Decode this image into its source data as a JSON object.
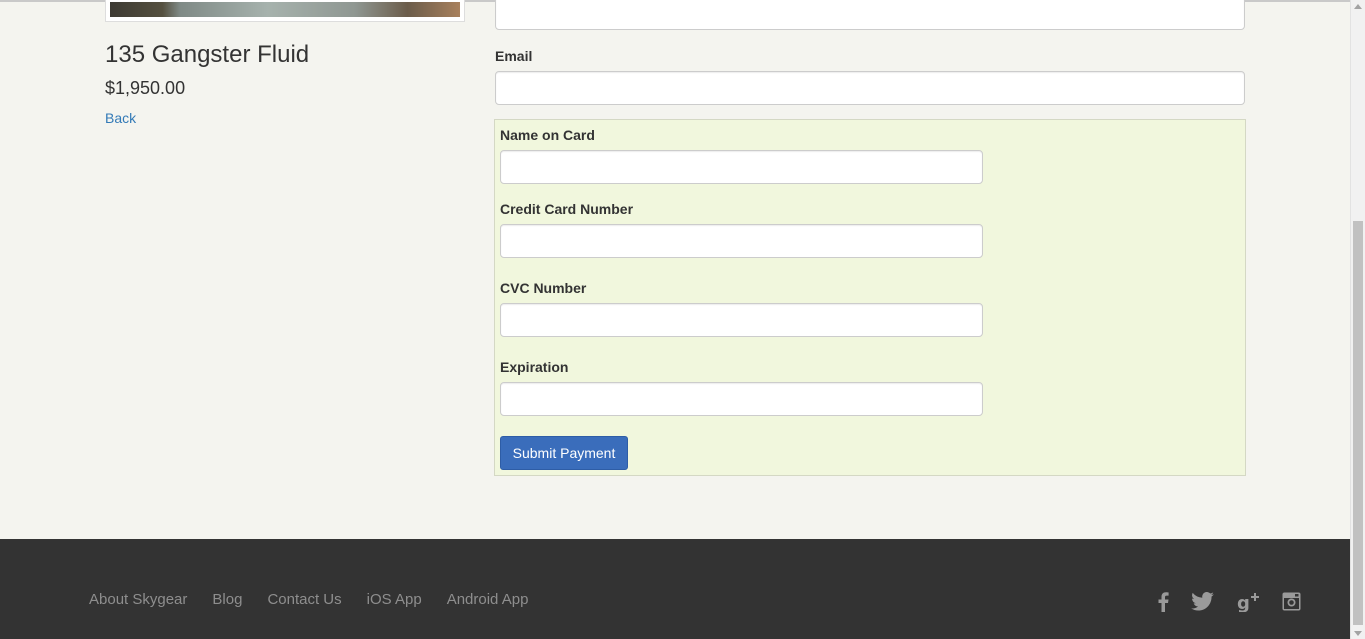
{
  "product": {
    "title": "135 Gangster Fluid",
    "price": "$1,950.00",
    "back_label": "Back"
  },
  "form": {
    "email_label": "Email",
    "email_value": "",
    "card": {
      "name_label": "Name on Card",
      "number_label": "Credit Card Number",
      "cvc_label": "CVC Number",
      "expiration_label": "Expiration",
      "submit_label": "Submit Payment"
    }
  },
  "footer": {
    "links": [
      "About Skygear",
      "Blog",
      "Contact Us",
      "iOS App",
      "Android App"
    ],
    "social_icons": [
      "facebook-icon",
      "twitter-icon",
      "google-plus-icon",
      "instagram-icon"
    ]
  },
  "colors": {
    "accent": "#337ab7",
    "button": "#3a6dbb",
    "card_panel": "#f1f7dd",
    "footer": "#333333"
  }
}
